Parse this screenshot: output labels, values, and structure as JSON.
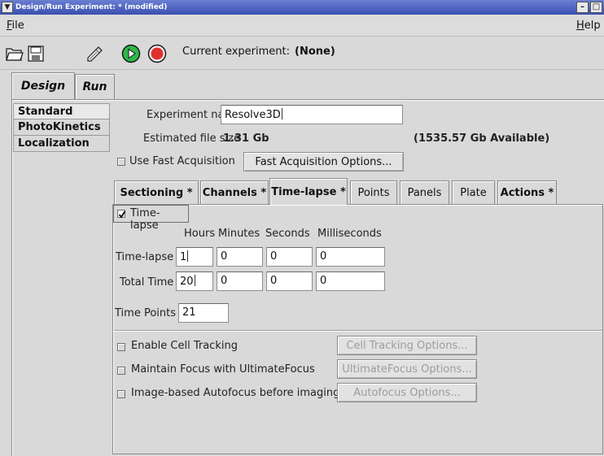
{
  "window": {
    "title": "Design/Run Experiment:  * (modified)"
  },
  "menu": {
    "file": "File",
    "help": "Help"
  },
  "toolbar": {
    "current_experiment_label": "Current experiment:",
    "current_experiment_value": "(None)"
  },
  "main_tabs": [
    {
      "label": "Design"
    },
    {
      "label": "Run"
    }
  ],
  "sidebar": {
    "items": [
      {
        "label": "Standard"
      },
      {
        "label": "PhotoKinetics"
      },
      {
        "label": "Localization"
      }
    ]
  },
  "experiment": {
    "name_label": "Experiment name",
    "name_value": "Resolve3D",
    "file_size_label": "Estimated file size",
    "file_size_value": "1.31 Gb",
    "available": "(1535.57 Gb Available)",
    "fast_acq_label": "Use Fast Acquisition",
    "fast_acq_options": "Fast Acquisition Options..."
  },
  "sub_tabs": [
    {
      "label": "Sectioning *"
    },
    {
      "label": "Channels *"
    },
    {
      "label": "Time-lapse *"
    },
    {
      "label": "Points"
    },
    {
      "label": "Panels"
    },
    {
      "label": "Plate"
    },
    {
      "label": "Actions *"
    }
  ],
  "timelapse": {
    "enable_label": "Time-lapse",
    "enabled": true,
    "col_headers": [
      "Hours",
      "Minutes",
      "Seconds",
      "Milliseconds"
    ],
    "row1": {
      "label": "Time-lapse",
      "values": [
        "1",
        "0",
        "0",
        "0"
      ]
    },
    "row2": {
      "label": "Total Time",
      "values": [
        "20",
        "0",
        "0",
        "0"
      ]
    },
    "time_points_label": "Time Points",
    "time_points_value": "21"
  },
  "options": [
    {
      "label": "Enable Cell Tracking",
      "button": "Cell Tracking Options..."
    },
    {
      "label": "Maintain Focus with UltimateFocus",
      "button": "UltimateFocus Options..."
    },
    {
      "label": "Image-based Autofocus before imaging",
      "button": "Autofocus Options..."
    }
  ]
}
